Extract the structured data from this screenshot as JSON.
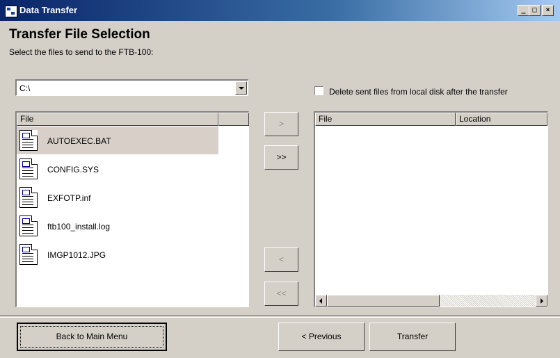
{
  "window": {
    "title": "Data Transfer",
    "controls": {
      "minimize": "_",
      "maximize": "□",
      "close": "×"
    }
  },
  "header": {
    "title": "Transfer File Selection",
    "subtitle": "Select the files to send to the FTB-100:"
  },
  "source": {
    "drive": "C:\\",
    "column_file": "File",
    "files": [
      {
        "name": "AUTOEXEC.BAT",
        "selected": true
      },
      {
        "name": "CONFIG.SYS",
        "selected": false
      },
      {
        "name": "EXFOTP.inf",
        "selected": false
      },
      {
        "name": "ftb100_install.log",
        "selected": false
      },
      {
        "name": "IMGP1012.JPG",
        "selected": false
      }
    ]
  },
  "options": {
    "delete_sent_label": "Delete sent files from local disk after the transfer",
    "delete_sent_checked": false
  },
  "transfer_buttons": {
    "add_one": ">",
    "add_all": ">>",
    "remove_one": "<",
    "remove_all": "<<"
  },
  "destination": {
    "column_file": "File",
    "column_location": "Location",
    "files": []
  },
  "footer": {
    "back_label": "Back to Main Menu",
    "previous_label": "< Previous",
    "transfer_label": "Transfer"
  },
  "icons": {
    "app": "data-transfer-icon",
    "file": "document-icon",
    "dropdown": "chevron-down-icon",
    "scroll_left": "arrow-left-icon",
    "scroll_right": "arrow-right-icon"
  },
  "colors": {
    "titlebar_start": "#0a246a",
    "titlebar_end": "#a6caf0",
    "window_bg": "#d4d0c8",
    "selection": "#d8d0c8"
  }
}
